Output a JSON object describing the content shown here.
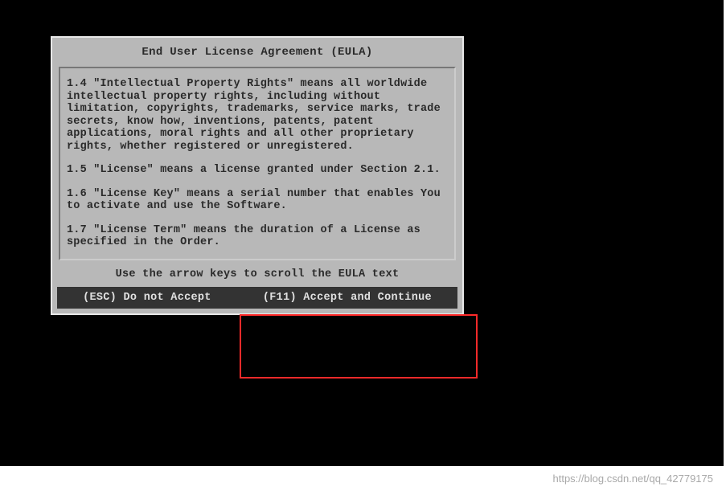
{
  "dialog": {
    "title": "End User License Agreement (EULA)",
    "sections": [
      "1.4 \"Intellectual Property Rights\" means all worldwide intellectual property rights, including without limitation, copyrights, trademarks, service marks, trade secrets, know how, inventions, patents, patent applications, moral rights and all other proprietary rights, whether registered or unregistered.",
      "1.5 \"License\" means a license granted under Section 2.1.",
      "1.6 \"License Key\" means a serial number that enables You to activate and use the Software.",
      "1.7 \"License Term\" means the duration of a License as specified in the Order."
    ],
    "scroll_hint": "Use the arrow keys to scroll the EULA text",
    "buttons": {
      "decline": "(ESC) Do not Accept",
      "accept": "(F11) Accept and Continue"
    }
  },
  "watermark": "https://blog.csdn.net/qq_42779175"
}
